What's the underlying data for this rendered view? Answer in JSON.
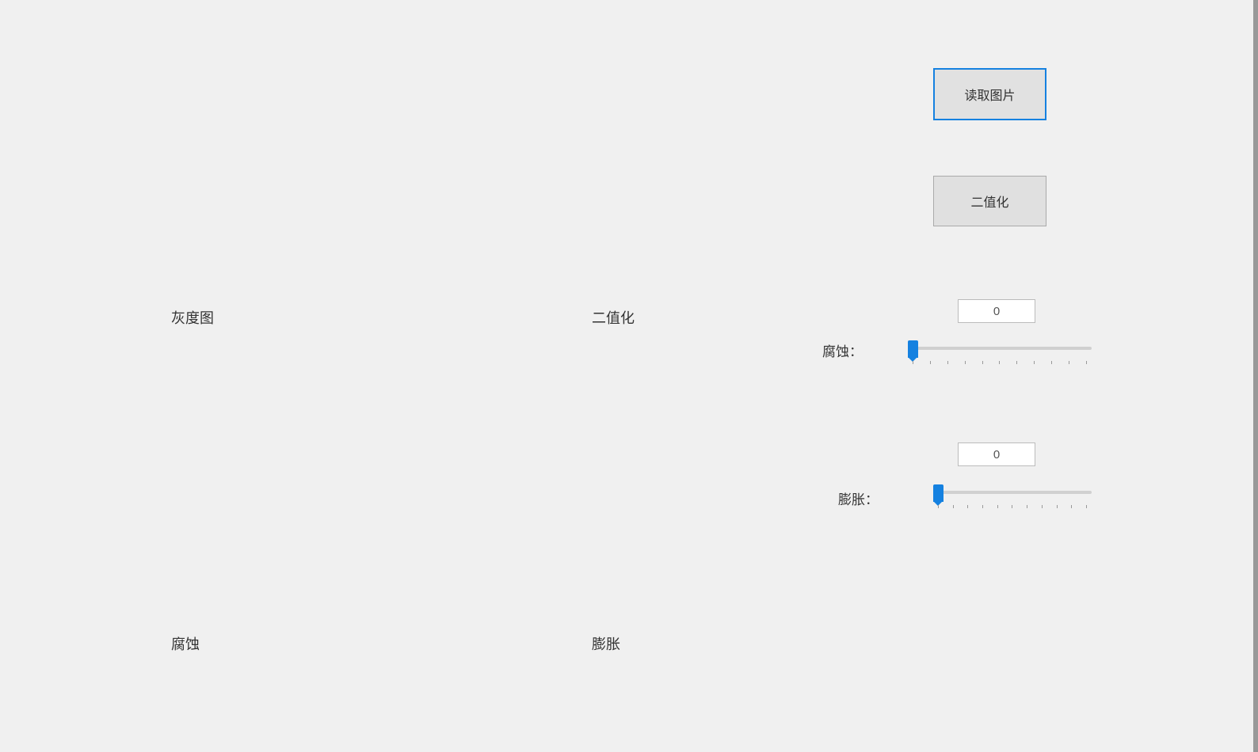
{
  "buttons": {
    "read_image": "读取图片",
    "binarize": "二值化"
  },
  "labels": {
    "grayscale": "灰度图",
    "binary": "二值化",
    "erode_bottom": "腐蚀",
    "dilate_bottom": "膨胀",
    "erode_slider": "腐蚀：",
    "dilate_slider": "膨胀："
  },
  "sliders": {
    "erode": {
      "value": 0,
      "min": 0,
      "max": 10
    },
    "dilate": {
      "value": 0,
      "min": 0,
      "max": 10
    }
  }
}
